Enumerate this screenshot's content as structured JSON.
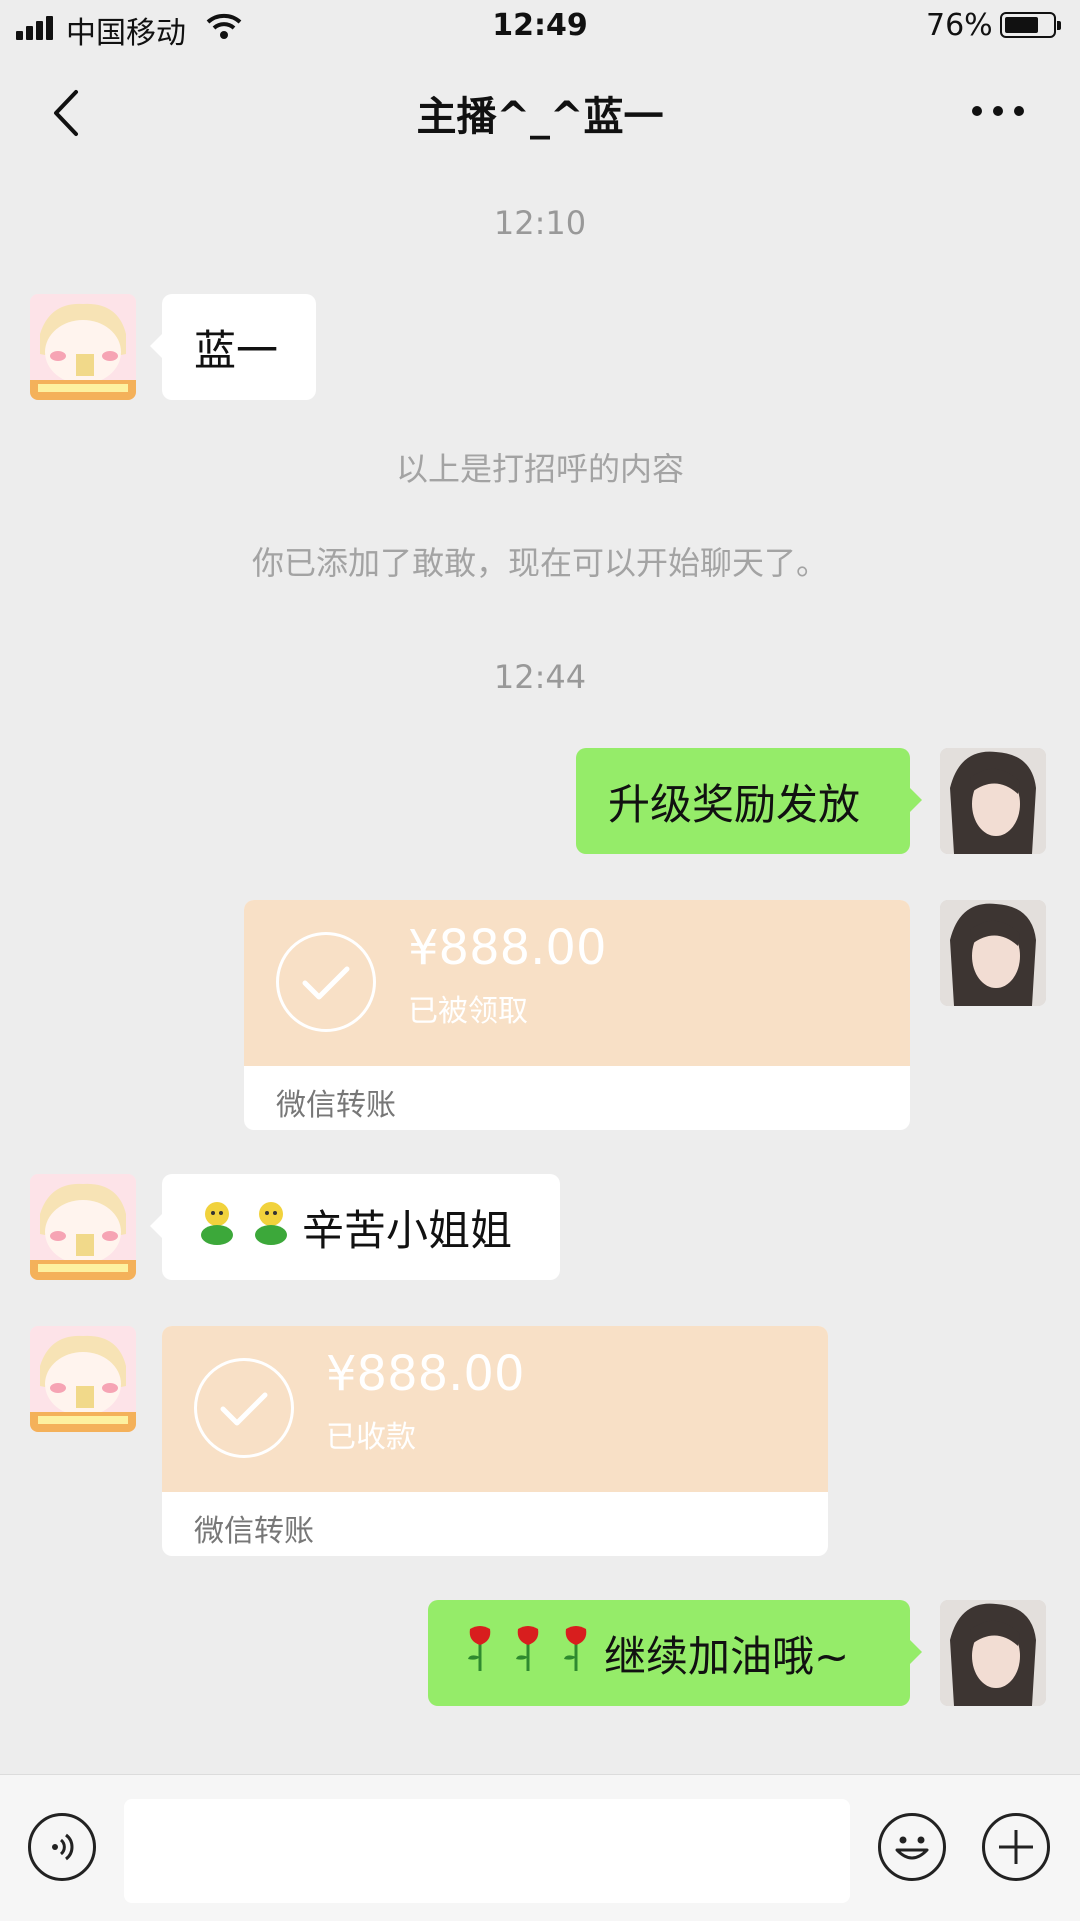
{
  "status": {
    "carrier": "中国移动",
    "time": "12:49",
    "battery": "76%",
    "battery_level": 0.76
  },
  "nav": {
    "title": "主播^_^蓝一"
  },
  "chat": {
    "timestamp1": "12:10",
    "greeting_msg": "蓝一",
    "sys1": "以上是打招呼的内容",
    "sys2": "你已添加了敢敢，现在可以开始聊天了。",
    "timestamp2": "12:44",
    "msg_upgrade": "升级奖励发放",
    "transfer_sent": {
      "amount": "¥888.00",
      "status": "已被领取",
      "label": "微信转账"
    },
    "msg_thanks": "辛苦小姐姐",
    "transfer_received": {
      "amount": "¥888.00",
      "status": "已收款",
      "label": "微信转账"
    },
    "msg_cheer": "继续加油哦~"
  },
  "icons": {
    "back": "chevron-left-icon",
    "more": "more-dots-icon",
    "voice": "voice-icon",
    "emoji": "emoji-icon",
    "plus": "plus-icon"
  },
  "colors": {
    "outgoing_bubble": "#95ec69",
    "incoming_bubble": "#ffffff",
    "transfer_card": "#f8e0c6",
    "background": "#ededed"
  }
}
